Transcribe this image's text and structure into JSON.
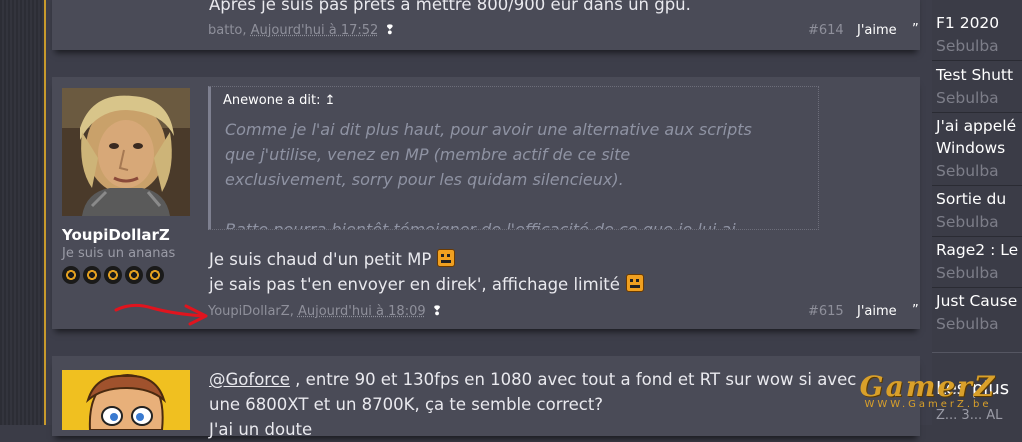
{
  "posts": [
    {
      "text_partial": "Apres je suis pas prets a mettre 800/900 eur dans un gpu.",
      "author": "batto",
      "date": "Aujourd'hui à 17:52",
      "number": "#614",
      "like_label": "J'aime"
    },
    {
      "user": {
        "name": "YoupiDollarZ",
        "title": "Je suis un ananas"
      },
      "quote": {
        "author_label": "Anewone a dit:",
        "jump_icon": "up-arrow",
        "lines": [
          "Comme je l'ai dit plus haut, pour avoir une alternative aux scripts",
          "que j'utilise, venez en MP (membre actif de ce site",
          "exclusivement, sorry pour les quidam silencieux).",
          "",
          "Batto pourra bientôt témoigner de l'efficacité de ce que je lui ai"
        ]
      },
      "lines": [
        "Je suis chaud d'un petit MP",
        "je sais pas t'en envoyer en direk', affichage limité"
      ],
      "author": "YoupiDollarZ",
      "date": "Aujourd'hui à 18:09",
      "number": "#615",
      "like_label": "J'aime"
    },
    {
      "mention": "@Goforce",
      "line1_rest": " , entre 90 et 130fps en 1080 avec tout a fond et RT sur wow si avec",
      "line2": "une 6800XT et un 8700K, ça te semble correct?",
      "line3_partial": "J'ai un doute"
    }
  ],
  "sidebar": {
    "items": [
      {
        "title": "F1 2020",
        "author": "Sebulba"
      },
      {
        "title": "Test Shutt",
        "author": "Sebulba"
      },
      {
        "title": "J'ai appelé",
        "title2": "Windows",
        "author": "Sebulba"
      },
      {
        "title": "Sortie du",
        "author": "Sebulba"
      },
      {
        "title": "Rage2 : Le",
        "author": "Sebulba"
      },
      {
        "title": "Just Cause",
        "author": "Sebulba"
      }
    ],
    "heading": "Les plus",
    "sub": "Z... 3... AL"
  },
  "watermark": {
    "logo": "GamerZ",
    "url": "WWW.GamerZ.be"
  },
  "colors": {
    "background": "#3b3c47",
    "post_bg": "#4a4b57",
    "accent": "#c89a2c",
    "annotation_arrow": "#e0141e"
  }
}
